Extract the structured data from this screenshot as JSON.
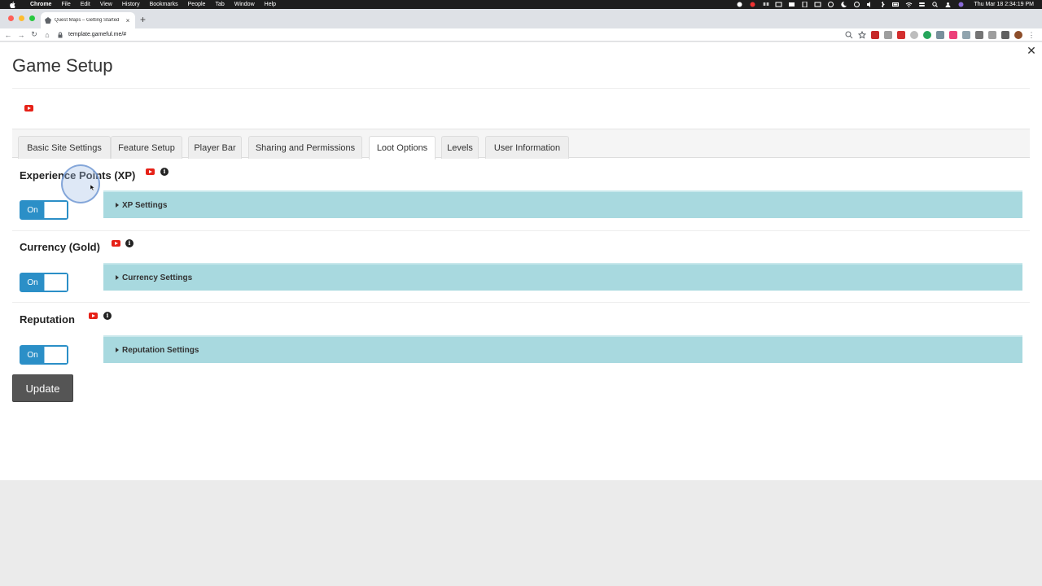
{
  "menubar": {
    "app": "Chrome",
    "items": [
      "File",
      "Edit",
      "View",
      "History",
      "Bookmarks",
      "People",
      "Tab",
      "Window",
      "Help"
    ],
    "clock": "Thu Mar 18  2:34:19 PM"
  },
  "browser": {
    "tab_title": "Quest Maps – Getting Started",
    "tab_close": "×",
    "new_tab": "+",
    "url": "template.gameful.me/#",
    "back": "←",
    "forward": "→",
    "reload": "↻",
    "home": "⌂"
  },
  "page": {
    "title": "Game Setup",
    "close": "✕",
    "tabs": [
      {
        "label": "Basic Site Settings"
      },
      {
        "label": "Feature Setup"
      },
      {
        "label": "Player Bar"
      },
      {
        "label": "Sharing and Permissions"
      },
      {
        "label": "Loot Options"
      },
      {
        "label": "Levels"
      },
      {
        "label": "User Information"
      }
    ],
    "active_tab": "Loot Options",
    "sections": [
      {
        "title": "Experience Points (XP)",
        "toggle": "On",
        "panel": "XP Settings",
        "info": "i"
      },
      {
        "title": "Currency (Gold)",
        "toggle": "On",
        "panel": "Currency Settings",
        "info": "i"
      },
      {
        "title": "Reputation",
        "toggle": "On",
        "panel": "Reputation Settings",
        "info": "i"
      }
    ],
    "update_label": "Update"
  },
  "colors": {
    "toggle_blue": "#2b8fc7",
    "panel_teal": "#a8d9df",
    "youtube_red": "#e62117",
    "update_gray": "#555555"
  },
  "icons": [
    "apple-icon",
    "youtube-icon",
    "info-icon",
    "close-icon",
    "lock-icon"
  ]
}
